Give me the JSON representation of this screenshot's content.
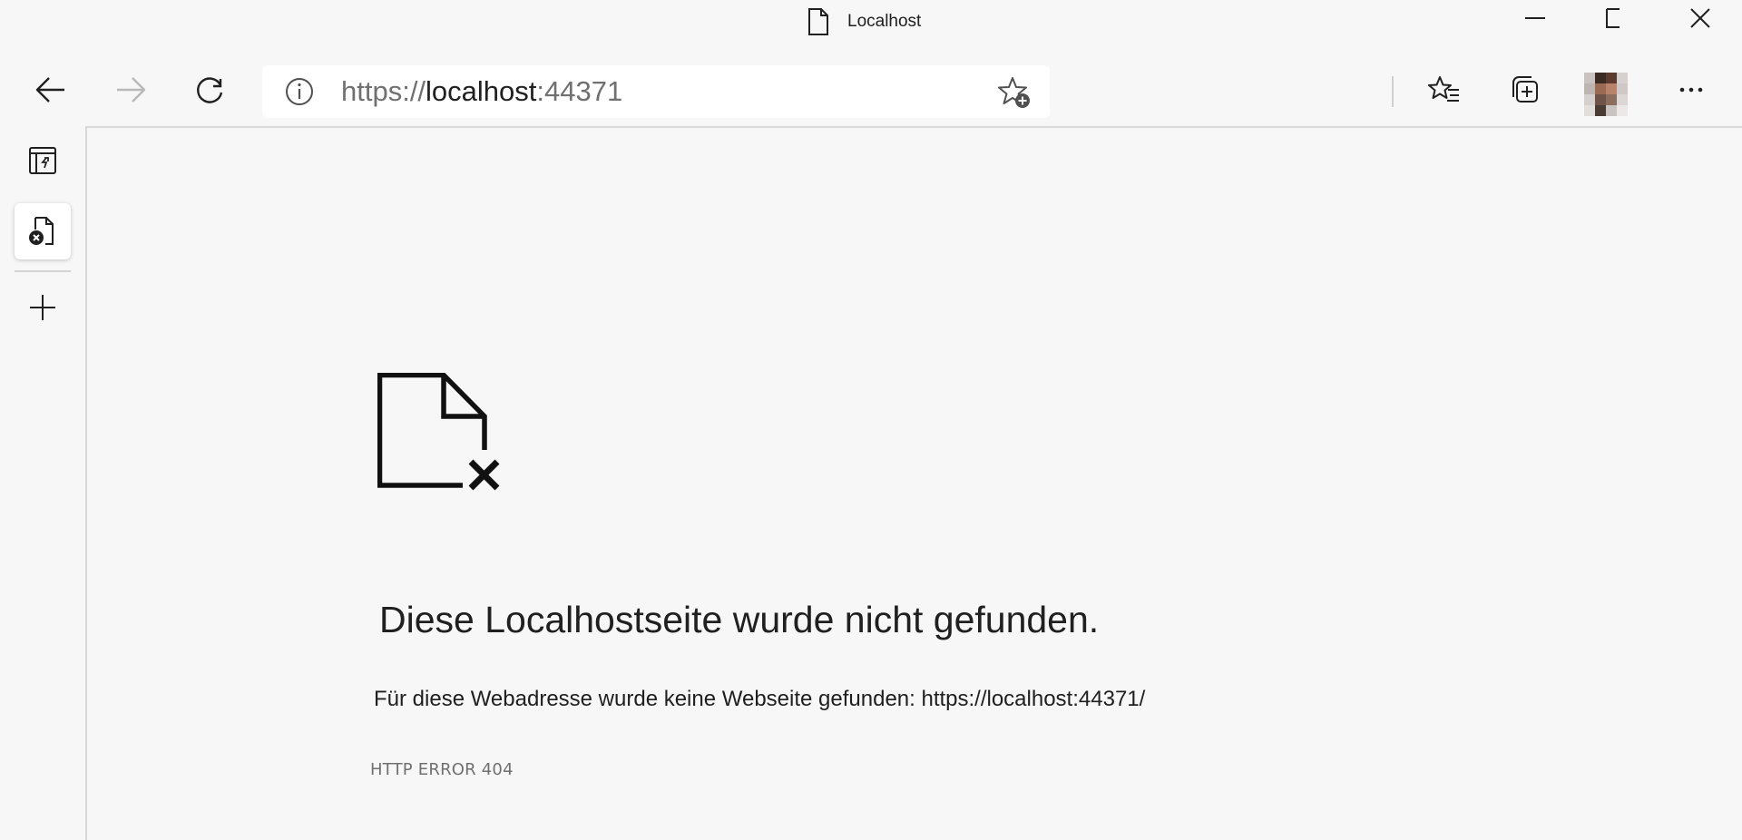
{
  "window": {
    "title": "Localhost",
    "page_icon": "document-icon",
    "controls": [
      "minimize-icon",
      "maximize-icon",
      "close-icon"
    ]
  },
  "toolbar": {
    "back_icon": "arrow-left-icon",
    "forward_icon": "arrow-right-icon",
    "reload_icon": "reload-icon",
    "favorites_icon": "favorites-list-icon",
    "collections_icon": "collections-icon",
    "more_icon": "more-ellipsis-icon"
  },
  "address_bar": {
    "info_icon": "info-icon",
    "url_scheme": "https://",
    "url_host": "localhost",
    "url_port": ":44371",
    "favorite_icon": "add-favorite-star-icon"
  },
  "sidebar": {
    "items": [
      {
        "icon": "tab-actions-icon"
      },
      {
        "icon": "error-page-tab-icon",
        "active": true
      },
      {
        "icon": "new-tab-plus-icon"
      }
    ]
  },
  "error_page": {
    "icon": "file-not-found-icon",
    "heading": "Diese Localhostseite wurde nicht gefunden.",
    "description": "Für diese Webadresse wurde keine Webseite gefunden: https://localhost:44371/",
    "error_code": "HTTP ERROR 404"
  },
  "colors": {
    "background": "#f7f7f7",
    "address_bar_bg": "#ffffff",
    "text_primary": "#202020",
    "text_muted": "#707070",
    "divider": "#d8d8d8"
  }
}
